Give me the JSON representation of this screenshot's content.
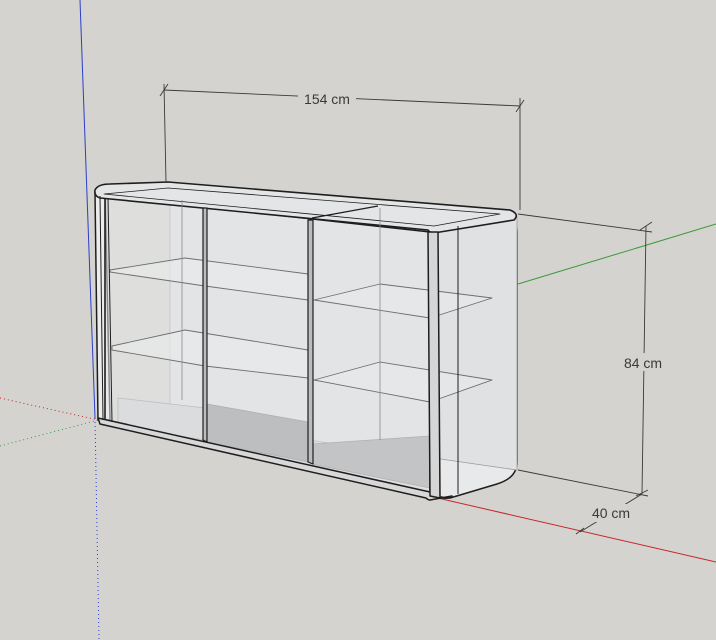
{
  "dimensions": {
    "width": "154 cm",
    "height": "84 cm",
    "depth": "40 cm"
  },
  "colors": {
    "background": "#d4d3cf",
    "axis_red": "#c8262a",
    "axis_green": "#3c9a3c",
    "axis_blue": "#2a3fc8",
    "edge": "#1e1e1e",
    "glass": "#e6e8ea",
    "shadow_floor": "#8f8f8f"
  }
}
